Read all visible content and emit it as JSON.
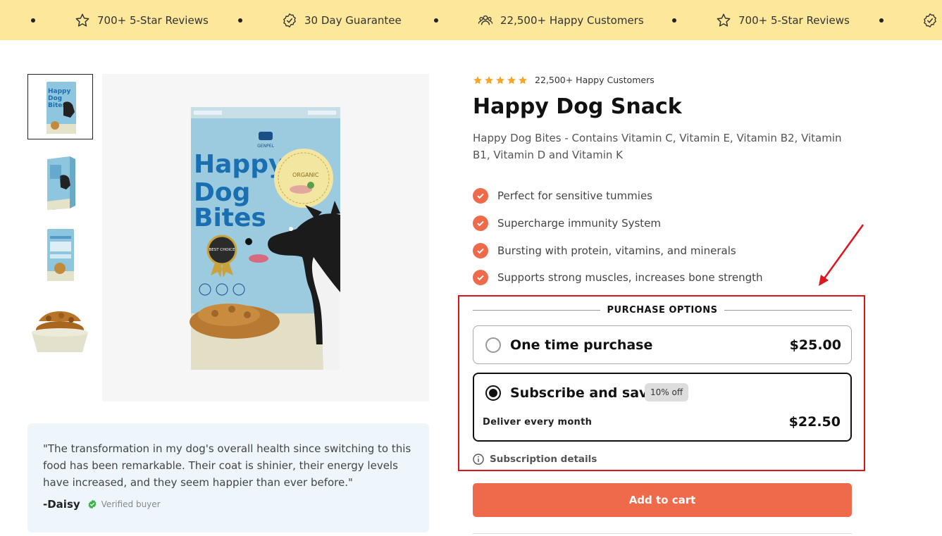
{
  "announcement": {
    "items": [
      {
        "icon": "star-icon",
        "text": "700+ 5-Star Reviews"
      },
      {
        "icon": "badge-check-icon",
        "text": "30 Day Guarantee"
      },
      {
        "icon": "users-icon",
        "text": "22,500+ Happy Customers"
      },
      {
        "icon": "star-icon",
        "text": "700+ 5-Star Reviews"
      }
    ]
  },
  "gallery": {
    "product_name_on_pack": [
      "Happy",
      "Dog",
      "Bites"
    ],
    "pack_brand": "GENPEL",
    "pack_seal": "BEST CHOICE",
    "pack_organic": "ORGANIC"
  },
  "testimonial": {
    "quote": "\"The transformation in my dog's overall health since switching to this food has been remarkable. Their coat is shinier, their energy levels have increased, and they seem happier than ever before.\"",
    "author": "-Daisy",
    "verified_label": "Verified buyer"
  },
  "product": {
    "rating_stars": 5,
    "rating_text": "22,500+ Happy Customers",
    "title": "Happy Dog Snack",
    "description": "Happy Dog Bites - Contains Vitamin C, Vitamin E, Vitamin B2, Vitamin B1, Vitamin D and Vitamin K",
    "features": [
      "Perfect for sensitive tummies",
      "Supercharge immunity System",
      "Bursting with protein, vitamins, and minerals",
      "Supports strong muscles, increases bone strength"
    ]
  },
  "purchase": {
    "header": "PURCHASE OPTIONS",
    "one_time": {
      "label": "One time purchase",
      "price": "$25.00",
      "selected": false
    },
    "subscribe": {
      "label": "Subscribe and save",
      "badge": "10% off",
      "deliver": "Deliver every month",
      "price": "$22.50",
      "selected": true
    },
    "details_label": "Subscription details",
    "add_to_cart": "Add to cart"
  },
  "colors": {
    "announcement_bg": "#fce79a",
    "accent": "#ef6a4a",
    "star": "#f5a623",
    "annotation_red": "#e0141b",
    "testimonial_bg": "#eef6fc",
    "verified_green": "#3bb54a"
  }
}
